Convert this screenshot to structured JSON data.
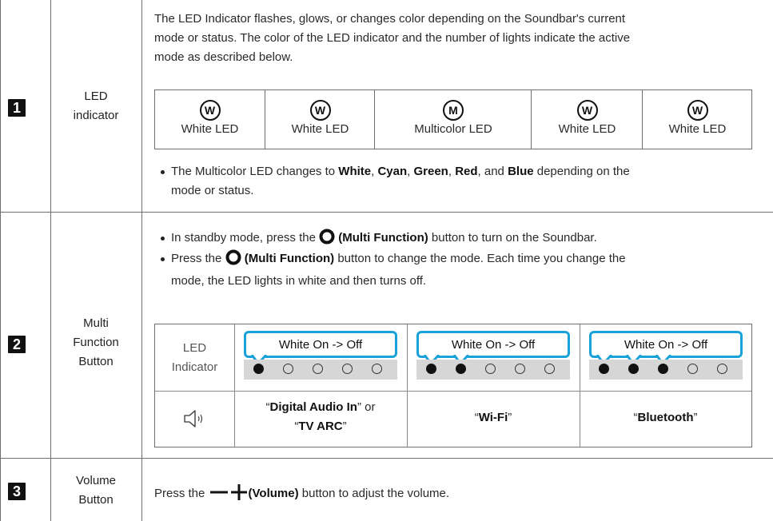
{
  "rows": [
    {
      "number": "1",
      "label_line1": "LED",
      "label_line2": "indicator"
    },
    {
      "number": "2",
      "label_line1": "Multi",
      "label_line2": "Function",
      "label_line3": "Button"
    },
    {
      "number": "3",
      "label_line1": "Volume",
      "label_line2": "Button"
    }
  ],
  "led_section": {
    "intro_line1": "The LED Indicator flashes, glows, or changes color depending on the Soundbar's current",
    "intro_line2": "mode or status. The color of the LED indicator and the number of lights indicate the active",
    "intro_line3": "mode as described below.",
    "cells": [
      {
        "glyph": "W",
        "text": "White LED"
      },
      {
        "glyph": "W",
        "text": "White LED"
      },
      {
        "glyph": "M",
        "text": "Multicolor LED"
      },
      {
        "glyph": "W",
        "text": "White LED"
      },
      {
        "glyph": "W",
        "text": "White LED"
      }
    ],
    "note_prefix": "The Multicolor LED changes to ",
    "note_colors": [
      "White",
      "Cyan",
      "Green",
      "Red",
      "Blue"
    ],
    "note_sep1": ", ",
    "note_and": ", and ",
    "note_suffix": " depending on the",
    "note_line2": "mode or status."
  },
  "multi_section": {
    "bullet1_pre": "In standby mode, press the ",
    "bullet1_bold": "(Multi Function)",
    "bullet1_post": " button to turn on the Soundbar.",
    "bullet2_pre": "Press the ",
    "bullet2_bold": "(Multi Function)",
    "bullet2_post": " button to change the mode. Each time you change the",
    "bullet2_line2": "mode, the LED lights in white and then turns off.",
    "indicator_label_line1": "LED",
    "indicator_label_line2": "Indicator",
    "bubble_text": "White On -> Off",
    "modes": [
      {
        "lit": 1,
        "line1_q1": "“",
        "line1_bold": "Digital Audio In",
        "line1_q2": "” or",
        "line2_q1": "“",
        "line2_bold": "TV ARC",
        "line2_q2": "”"
      },
      {
        "lit": 2,
        "q1": "“",
        "bold": "Wi-Fi",
        "q2": "”"
      },
      {
        "lit": 3,
        "q1": "“",
        "bold": "Bluetooth",
        "q2": "”"
      }
    ]
  },
  "volume_section": {
    "text_pre": "Press the ",
    "text_bold": "(Volume)",
    "text_post": " button to adjust the volume."
  },
  "colors": {
    "accent_bubble": "#1aa3d8",
    "strip_gray": "#d6d6d6",
    "line_gray": "#6e6e6e"
  },
  "icons": [
    "multi-function-icon",
    "speaker-sound-icon",
    "minus-icon",
    "plus-icon",
    "led-w-icon",
    "led-m-icon"
  ]
}
